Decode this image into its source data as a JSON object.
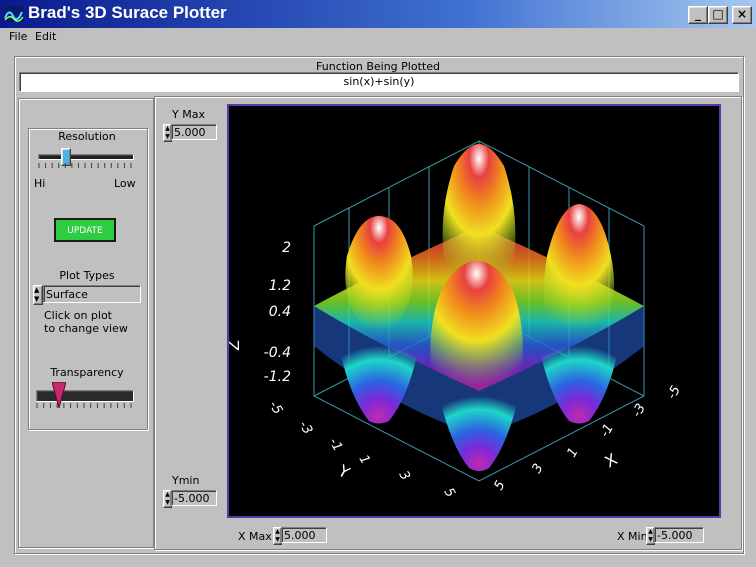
{
  "window": {
    "title": "Brad's 3D Surace Plotter",
    "minimize": "_",
    "maximize": "□",
    "close": "×"
  },
  "menu": [
    {
      "label": "File"
    },
    {
      "label": "Edit"
    }
  ],
  "function_panel": {
    "caption": "Function Being Plotted",
    "value": "sin(x)+sin(y)"
  },
  "controls": {
    "resolution_label": "Resolution",
    "resolution_hi": "Hi",
    "resolution_low": "Low",
    "resolution_level": 0.27,
    "update_label": "UPDATE",
    "plot_types_label": "Plot Types",
    "plot_type_value": "Surface",
    "hint_line1": "Click on plot",
    "hint_line2": "to change view",
    "transparency_label": "Transparency",
    "transparency_level": 0.2
  },
  "axes_inputs": {
    "ymax_label": "Y Max",
    "ymax_value": "5.000",
    "ymin_label": "Ymin",
    "ymin_value": "-5.000",
    "xmax_label": "X Max",
    "xmax_value": "5.000",
    "xmin_label": "X Min",
    "xmin_value": "-5.000"
  },
  "plot": {
    "z_axis_label": "Z",
    "y_axis_label": "Y",
    "x_axis_label": "X",
    "z_ticks": [
      "2",
      "1.2",
      "0.4",
      "-0.4",
      "-1.2"
    ],
    "y_ticks": [
      "-5",
      "-3",
      "-1",
      "1",
      "3",
      "5"
    ],
    "x_ticks": [
      "5",
      "3",
      "1",
      "-1",
      "-3",
      "-5"
    ]
  }
}
